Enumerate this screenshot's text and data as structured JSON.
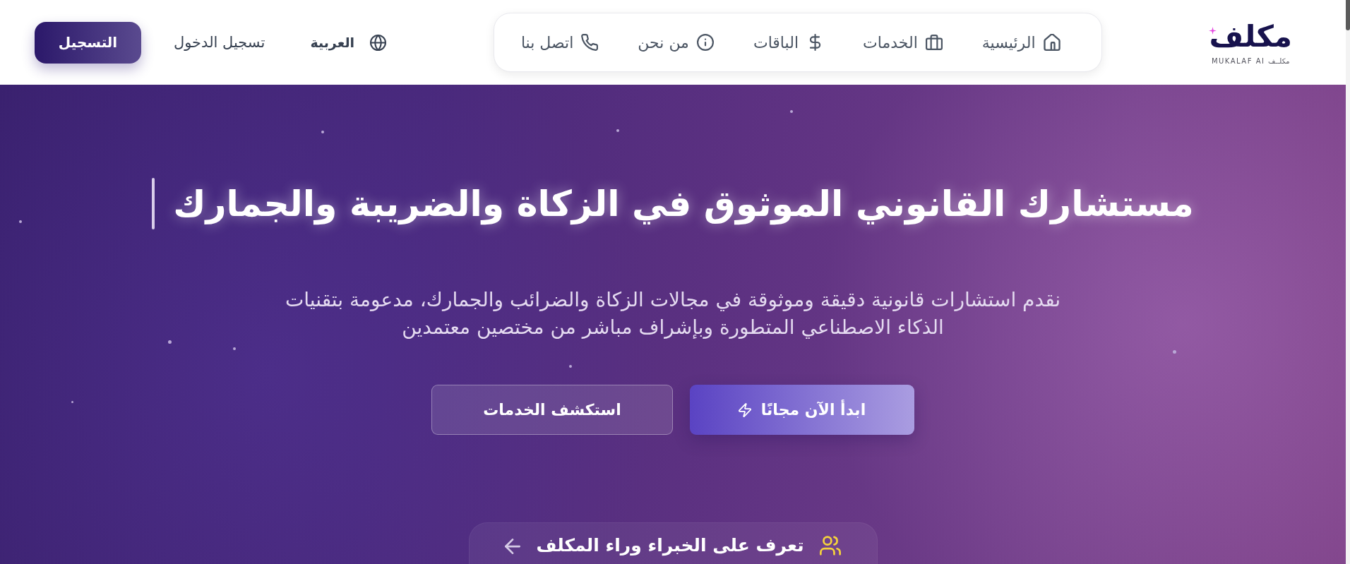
{
  "logo": {
    "mark": "مكلف",
    "caption": "MUKALAF AI مكلــف"
  },
  "nav": [
    {
      "kind": "home",
      "label": "الرئيسية"
    },
    {
      "kind": "services",
      "label": "الخدمات"
    },
    {
      "kind": "packages",
      "label": "الباقات"
    },
    {
      "kind": "about",
      "label": "من نحن"
    },
    {
      "kind": "contact",
      "label": "اتصل بنا"
    }
  ],
  "actions": [
    {
      "kind": "language",
      "label": "العربية"
    },
    {
      "kind": "login",
      "label": "تسجيل الدخول"
    },
    {
      "kind": "signup",
      "label": "التسجيل"
    }
  ],
  "hero": {
    "title": "مستشارك القانوني الموثوق في الزكاة والضريبة والجمارك",
    "subtitle": "نقدم استشارات قانونية دقيقة وموثوقة في مجالات الزكاة والضرائب والجمارك، مدعومة بتقنيات الذكاء الاصطناعي المتطورة وبإشراف مباشر من مختصين معتمدين",
    "buttons": [
      {
        "kind": "primary",
        "label": "ابدأ الآن مجانًا"
      },
      {
        "kind": "outline",
        "label": "استكشف الخدمات"
      }
    ],
    "card": {
      "label": "تعرف على الخبراء وراء المكلف"
    }
  }
}
